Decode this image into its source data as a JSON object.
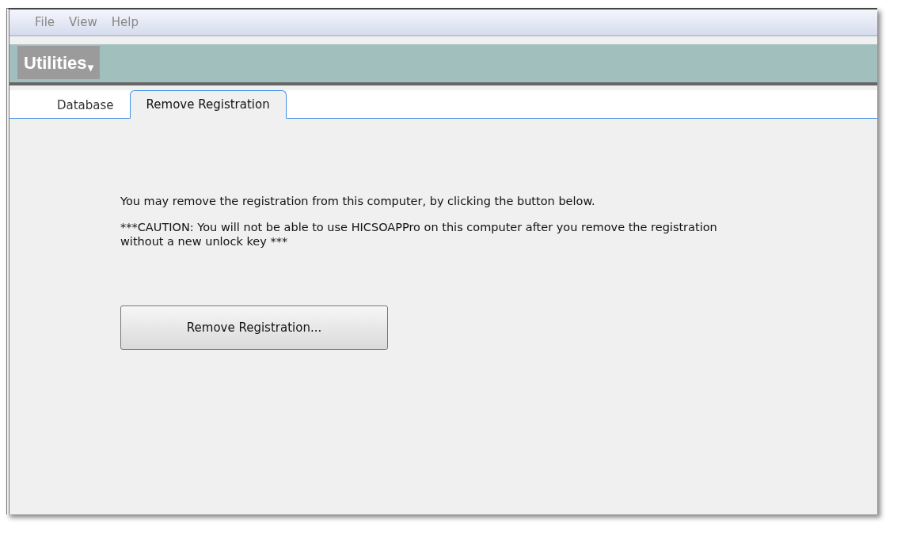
{
  "menu": [
    "File",
    "View",
    "Help"
  ],
  "module": {
    "title": "Utilities",
    "caret": "▾"
  },
  "tabs": [
    {
      "label": "Database",
      "selected": false
    },
    {
      "label": "Remove Registration",
      "selected": true
    }
  ],
  "content": {
    "intro": "You may remove the registration from this computer, by clicking the button below.",
    "caution": "***CAUTION: You will not be able to use HICSOAPPro on this computer after you remove the registration without a new unlock key ***",
    "button": "Remove Registration..."
  }
}
